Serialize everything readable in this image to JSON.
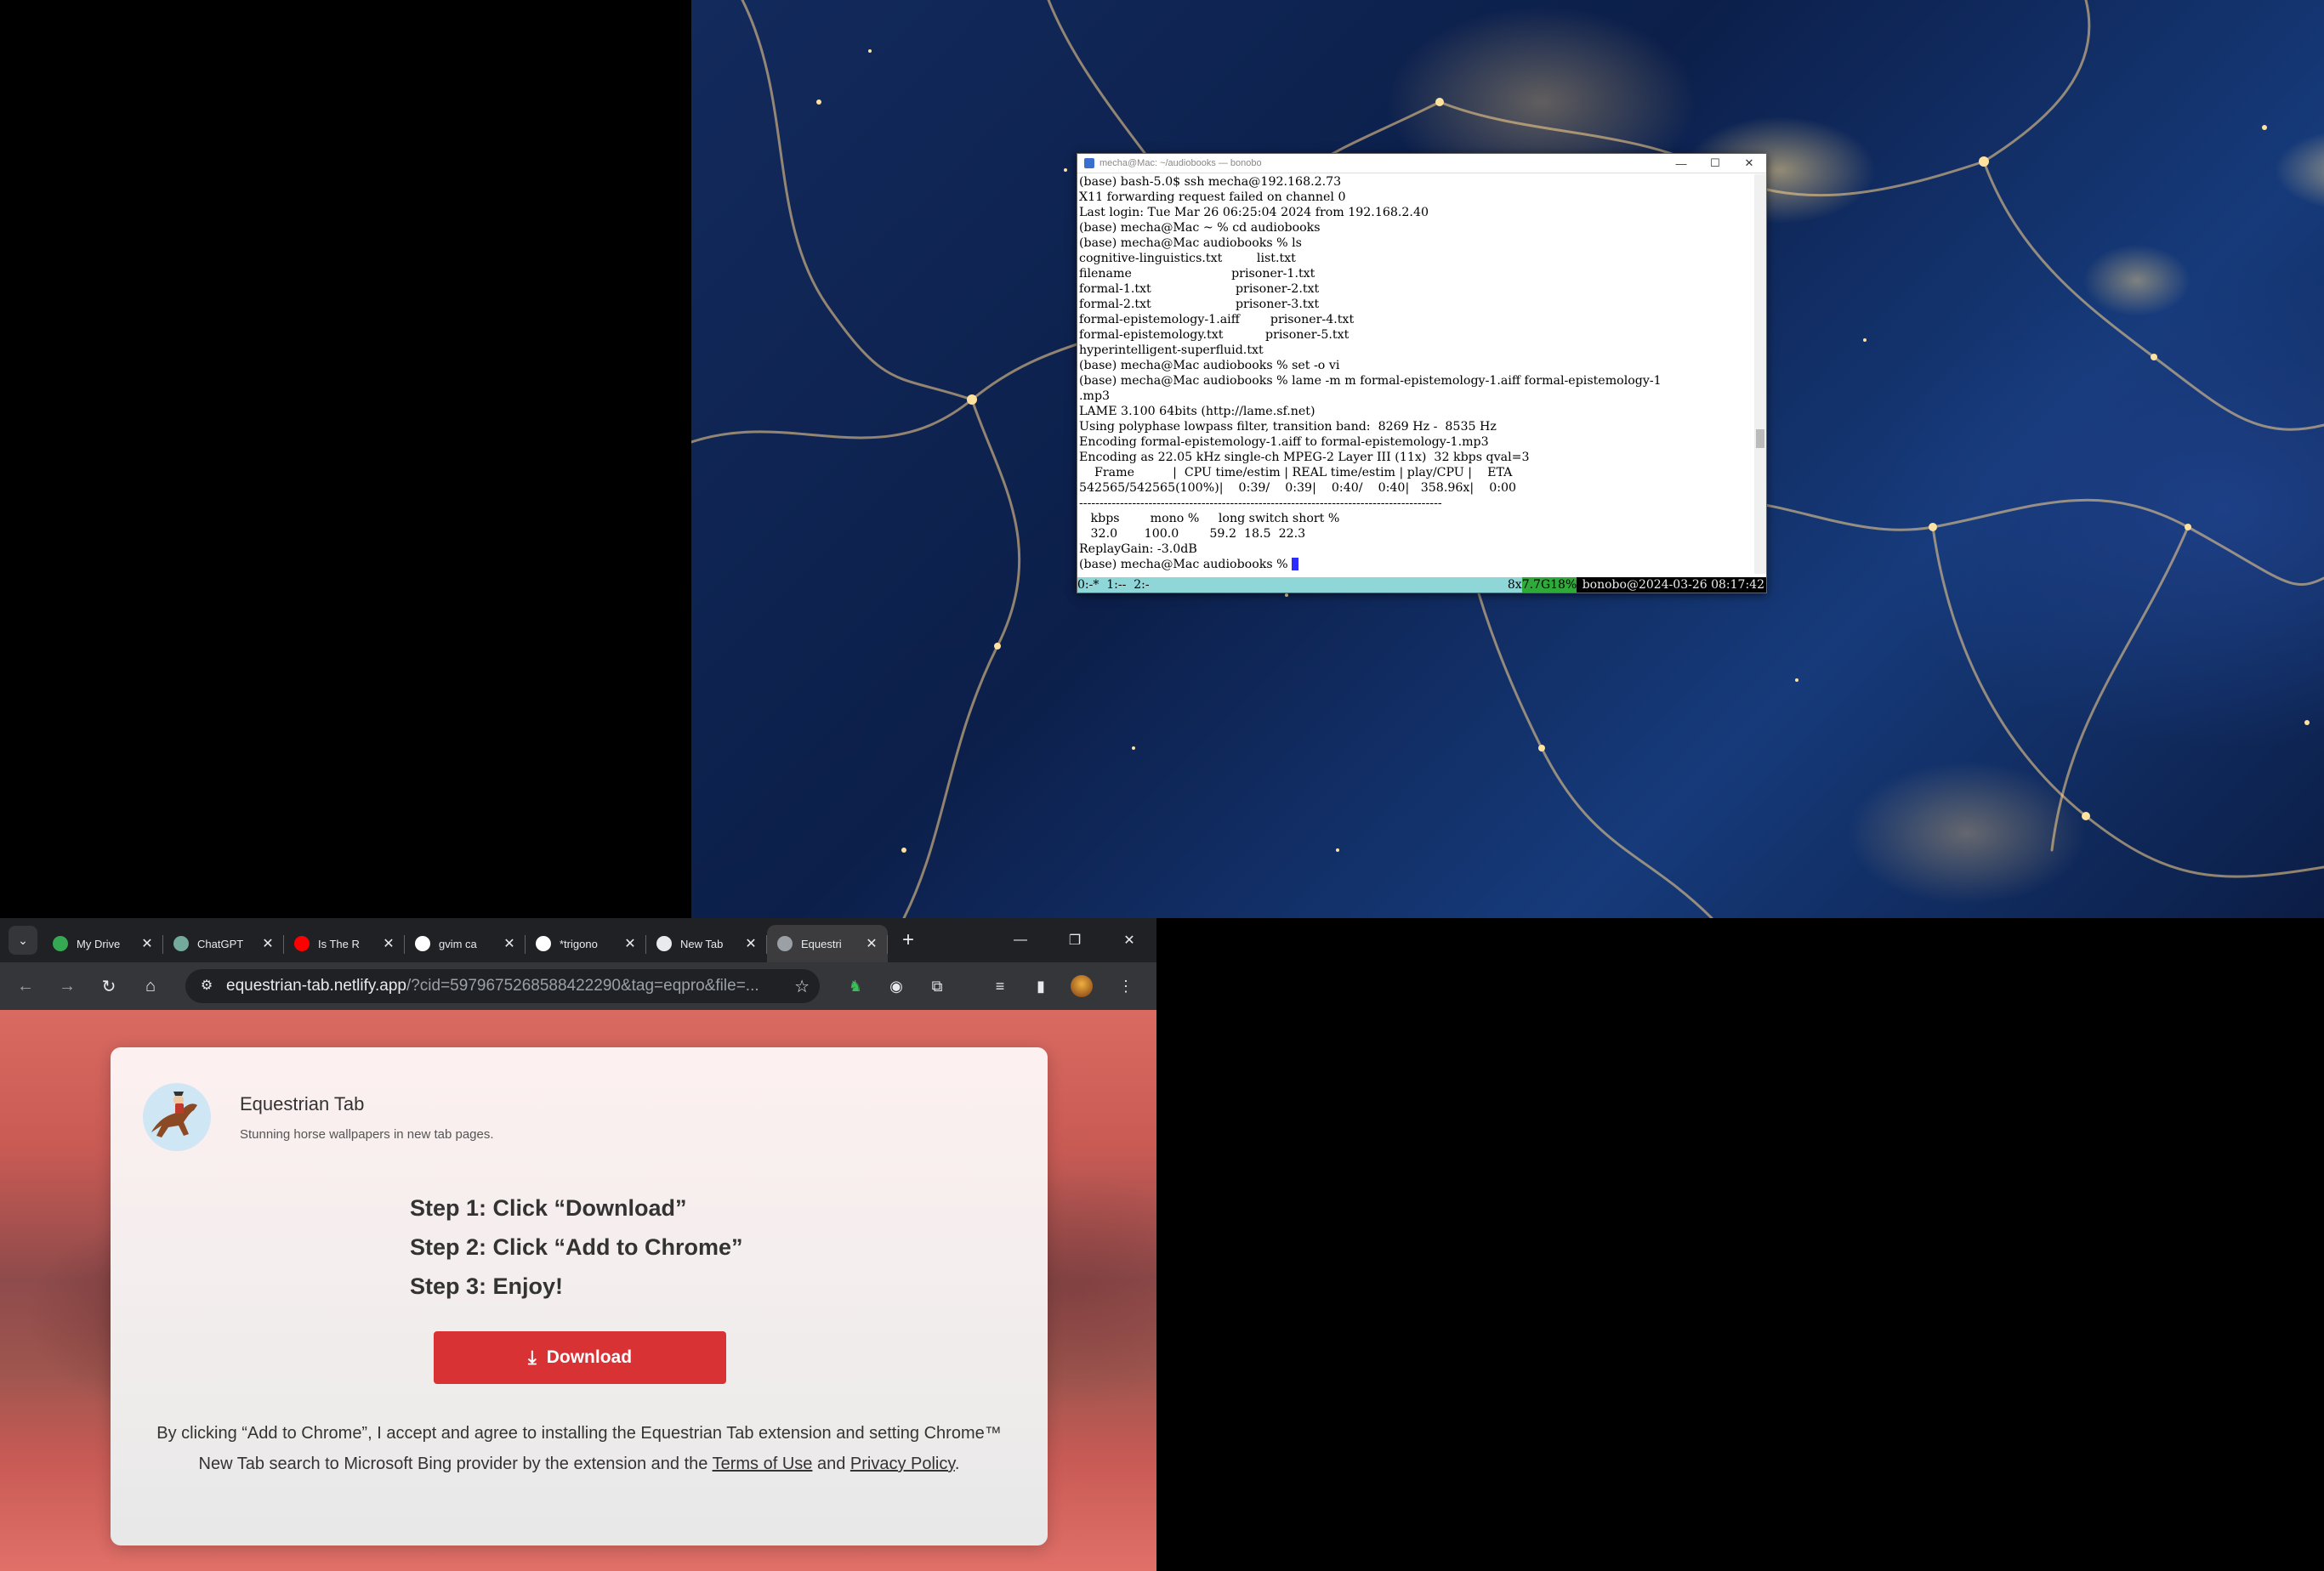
{
  "terminal": {
    "title": "mecha@Mac: ~/audiobooks — bonobo",
    "lines": [
      "(base) bash-5.0$ ssh mecha@192.168.2.73",
      "X11 forwarding request failed on channel 0",
      "Last login: Tue Mar 26 06:25:04 2024 from 192.168.2.40",
      "(base) mecha@Mac ~ % cd audiobooks",
      "(base) mecha@Mac audiobooks % ls",
      "cognitive-linguistics.txt         list.txt",
      "filename                          prisoner-1.txt",
      "formal-1.txt                      prisoner-2.txt",
      "formal-2.txt                      prisoner-3.txt",
      "formal-epistemology-1.aiff        prisoner-4.txt",
      "formal-epistemology.txt           prisoner-5.txt",
      "hyperintelligent-superfluid.txt",
      "(base) mecha@Mac audiobooks % set -o vi",
      "(base) mecha@Mac audiobooks % lame -m m formal-epistemology-1.aiff formal-epistemology-1",
      ".mp3",
      "LAME 3.100 64bits (http://lame.sf.net)",
      "Using polyphase lowpass filter, transition band:  8269 Hz -  8535 Hz",
      "Encoding formal-epistemology-1.aiff to formal-epistemology-1.mp3",
      "Encoding as 22.05 kHz single-ch MPEG-2 Layer III (11x)  32 kbps qval=3",
      "    Frame          |  CPU time/estim | REAL time/estim | play/CPU |    ETA",
      "542565/542565(100%)|    0:39/    0:39|    0:40/    0:40|   358.96x|    0:00",
      "-----------------------------------------------------------------------------------------",
      "   kbps        mono %     long switch short %",
      "   32.0       100.0        59.2  18.5  22.3",
      "ReplayGain: -3.0dB",
      "(base) mecha@Mac audiobooks % "
    ],
    "status_left": "0:-*  1:--  2:-",
    "status_load": "8x",
    "status_mem": "7.7G18%",
    "status_right": " bonobo@2024-03-26 08:17:42"
  },
  "browser": {
    "tabs": [
      {
        "label": "My Drive",
        "icon": "google-drive-icon",
        "color": "#34a853"
      },
      {
        "label": "ChatGPT",
        "icon": "chatgpt-icon",
        "color": "#74aa9c"
      },
      {
        "label": "Is The R",
        "icon": "youtube-icon",
        "color": "#ff0000"
      },
      {
        "label": "gvim ca",
        "icon": "google-icon",
        "color": "#ffffff"
      },
      {
        "label": "*trigono",
        "icon": "google-icon",
        "color": "#ffffff"
      },
      {
        "label": "New Tab",
        "icon": "chrome-icon",
        "color": "#e8eaed"
      },
      {
        "label": "Equestri",
        "icon": "globe-icon",
        "color": "#9aa0a6"
      }
    ],
    "active_tab": 6,
    "url_host": "equestrian-tab.netlify.app",
    "url_rest": "/?cid=5979675268588422290&tag=eqpro&file=...",
    "minimize": "—",
    "restore": "❐",
    "close": "✕",
    "new_tab": "+"
  },
  "page": {
    "app_name": "Equestrian Tab",
    "tagline": "Stunning horse wallpapers in new tab pages.",
    "steps": [
      "Step 1: Click “Download”",
      "Step 2: Click “Add to Chrome”",
      "Step 3: Enjoy!"
    ],
    "download_label": "Download",
    "disclaimer_1": "By clicking “Add to Chrome”, I accept and agree to installing the Equestrian Tab extension and setting Chrome™ New Tab search to Microsoft Bing provider by the extension",
    "disclaimer_2": "and the ",
    "terms_link": "Terms of Use",
    "disclaimer_3": " and ",
    "privacy_link": "Privacy Policy",
    "disclaimer_4": "."
  }
}
